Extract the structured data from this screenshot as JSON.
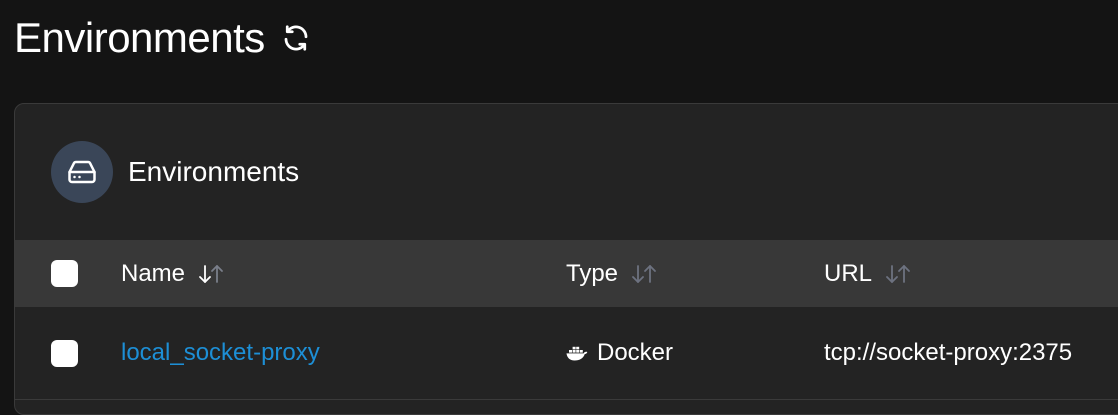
{
  "page": {
    "title": "Environments"
  },
  "panel": {
    "title": "Environments",
    "icon": "hard-drive-icon"
  },
  "table": {
    "columns": [
      {
        "label": "Name",
        "sort": "active-desc"
      },
      {
        "label": "Type",
        "sort": "none"
      },
      {
        "label": "URL",
        "sort": "none"
      }
    ],
    "rows": [
      {
        "name": "local_socket-proxy",
        "type": "Docker",
        "type_icon": "docker-icon",
        "url": "tcp://socket-proxy:2375"
      }
    ]
  },
  "colors": {
    "background": "#141414",
    "panel": "#232323",
    "header_row": "#383838",
    "link": "#1d8fd6",
    "icon_circle": "#3a4658"
  }
}
